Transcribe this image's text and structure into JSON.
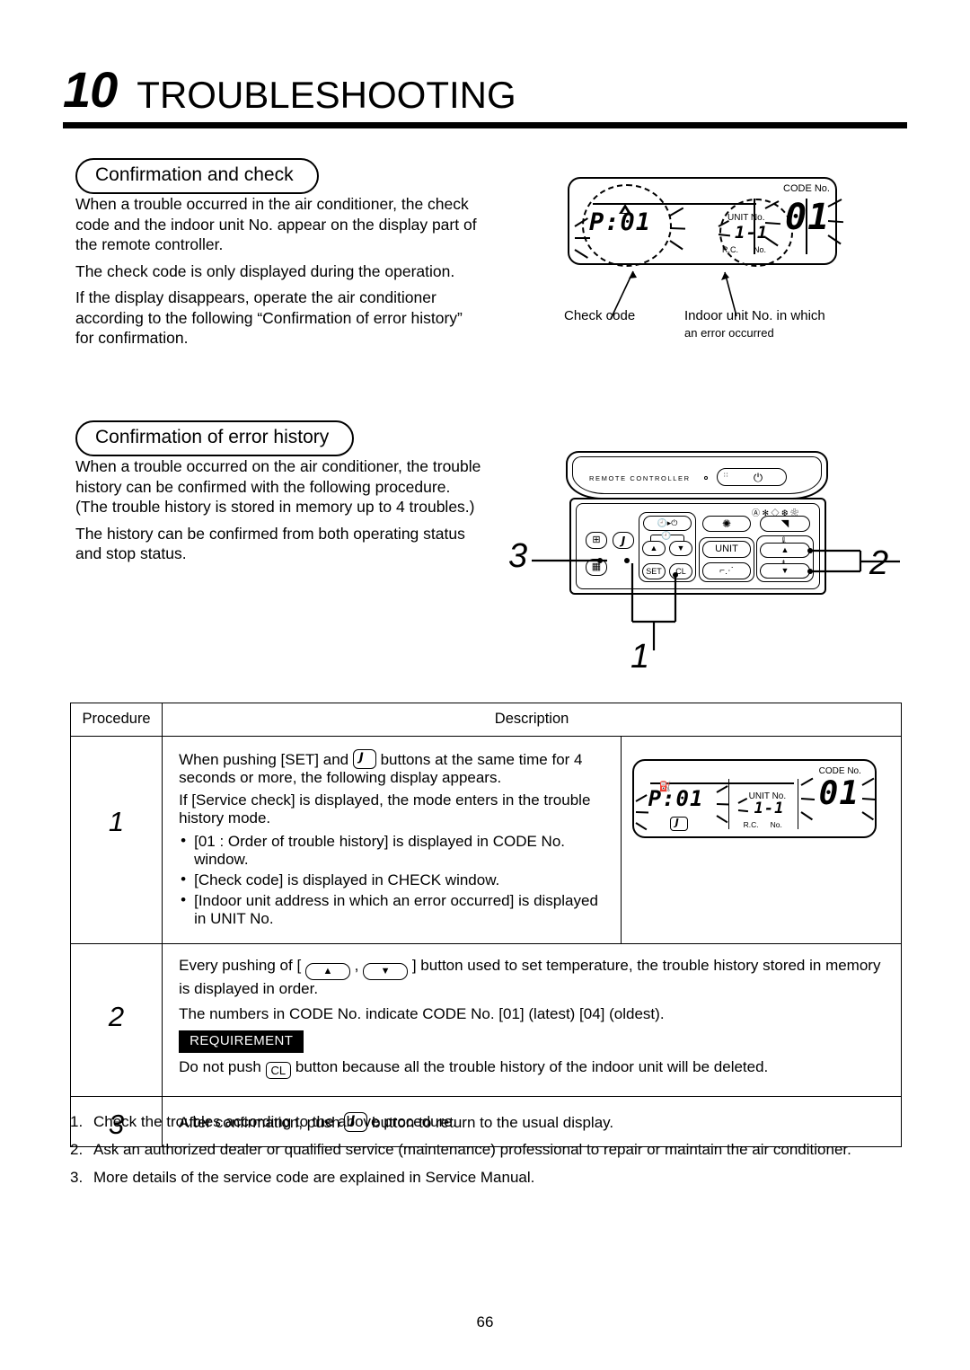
{
  "chapter": {
    "number": "10",
    "title": "TROUBLESHOOTING"
  },
  "section1": {
    "heading": "Confirmation and check",
    "paragraphs": [
      "When a trouble occurred in the air conditioner, the check code and the indoor unit No. appear on the display part of the remote controller.",
      "The check code is only displayed during the operation.",
      "If the display disappears, operate the air conditioner according to the following “Confirmation of error history” for confirmation."
    ]
  },
  "section2": {
    "heading": "Confirmation of error history",
    "paragraphs": [
      "When a trouble occurred on the air conditioner, the trouble history can be confirmed with the following procedure. (The trouble history is stored in memory up to 4 troubles.)",
      "The history can be confirmed from both operating status and stop status."
    ]
  },
  "lcd_top": {
    "check_code": "P:01",
    "unit_no_label": "UNIT No.",
    "unit_no_value": "1-1",
    "rc_label": "R.C.",
    "rc_no_label": "No.",
    "code_no_label": "CODE No.",
    "code_no_value": "01",
    "warning_icon": "warning-triangle-icon",
    "annotation_left": "Check code",
    "annotation_right": "Indoor unit No. in which\nan error occurred",
    "annotation_right_line1": "Indoor unit No. in which",
    "annotation_right_line2": "an error occurred"
  },
  "remote": {
    "brand_label": "REMOTE CONTROLLER",
    "power_icon": "power-icon",
    "sensor_icon": "receiver-dot-icon",
    "buttons": {
      "timer_onoff": "timer-power-icon",
      "timer_up": "▲",
      "timer_down": "▼",
      "set": "SET",
      "cl": "CL",
      "fan_speed": "fan-icon",
      "unit": "UNIT",
      "louver": "louver-icon",
      "mode": "mode-icon",
      "temp_up": "▲",
      "temp_down": "▼",
      "filter": "filter-grid-icon",
      "service": "wrench-icon",
      "vent": "vent-icon"
    },
    "mode_icons": "Ⓐ ✻ ◇ ❆ ❀",
    "callouts": [
      {
        "id": "1",
        "label": "1"
      },
      {
        "id": "2",
        "label": "2"
      },
      {
        "id": "3",
        "label": "3"
      }
    ]
  },
  "table": {
    "headers": {
      "procedure": "Procedure",
      "description": "Description"
    },
    "rows": [
      {
        "number": "1",
        "lines": [
          "When pushing [SET] and",
          "buttons at the same time for 4 seconds or more, the following display appears.",
          "If [Service check] is displayed, the mode enters in the trouble history mode."
        ],
        "bullets": [
          "[01 : Order of trouble history] is displayed in CODE No. window.",
          "[Check code] is displayed in CHECK window.",
          "[Indoor unit address in which an error occurred] is displayed in UNIT No."
        ],
        "lcd": {
          "service_icon": "service-oil-can-icon",
          "check_code": "P:01",
          "wrench_icon": "wrench-icon",
          "unit_no_label": "UNIT No.",
          "unit_no_value": "1-1",
          "rc_label": "R.C.",
          "rc_no_label": "No.",
          "code_no_label": "CODE No.",
          "code_no_value": "01"
        }
      },
      {
        "number": "2",
        "text_before_keys": "Every pushing of [",
        "key_up": "▲",
        "key_comma": ",",
        "key_down": "▼",
        "text_after_keys": "] button used to set temperature, the trouble history stored in memory is displayed in order.",
        "line2": "The numbers in CODE No. indicate CODE No.  [01] (latest)      [04] (oldest).",
        "requirement_badge": "REQUIREMENT",
        "requirement_before": "Do not push",
        "requirement_key": "CL",
        "requirement_after": "button because all the trouble history of the indoor unit will be deleted."
      },
      {
        "number": "3",
        "text_before_key": "After confirmation, push",
        "key": "wrench-icon",
        "text_after_key": "button to return to the usual display."
      }
    ]
  },
  "notes": [
    {
      "n": "1.",
      "text": "Check the troubles according to the above procedure."
    },
    {
      "n": "2.",
      "text": "Ask an authorized dealer or qualified service (maintenance) professional to repair or maintain the air conditioner."
    },
    {
      "n": "3.",
      "text": "More details of the service code are explained in Service Manual."
    }
  ],
  "page_number": "66"
}
